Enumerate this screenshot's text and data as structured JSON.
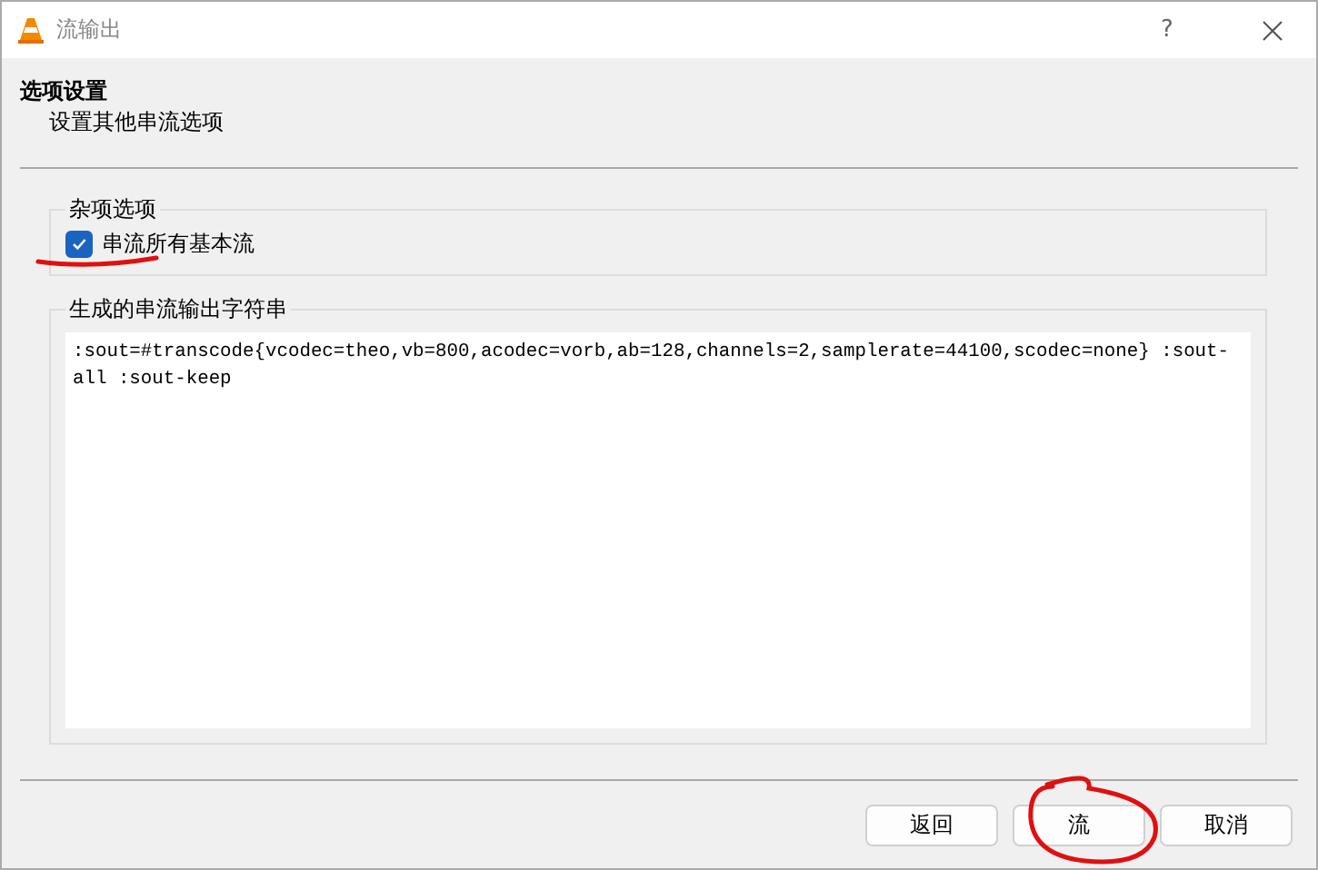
{
  "window": {
    "title": "流输出",
    "help": "?"
  },
  "header": {
    "title": "选项设置",
    "subtitle": "设置其他串流选项"
  },
  "misc_group": {
    "title": "杂项选项",
    "checkbox": {
      "label": "串流所有基本流",
      "checked": true
    }
  },
  "output_group": {
    "title": "生成的串流输出字符串",
    "value": ":sout=#transcode{vcodec=theo,vb=800,acodec=vorb,ab=128,channels=2,samplerate=44100,scodec=none} :sout-all :sout-keep"
  },
  "buttons": [
    "返回",
    "流",
    "取消"
  ]
}
